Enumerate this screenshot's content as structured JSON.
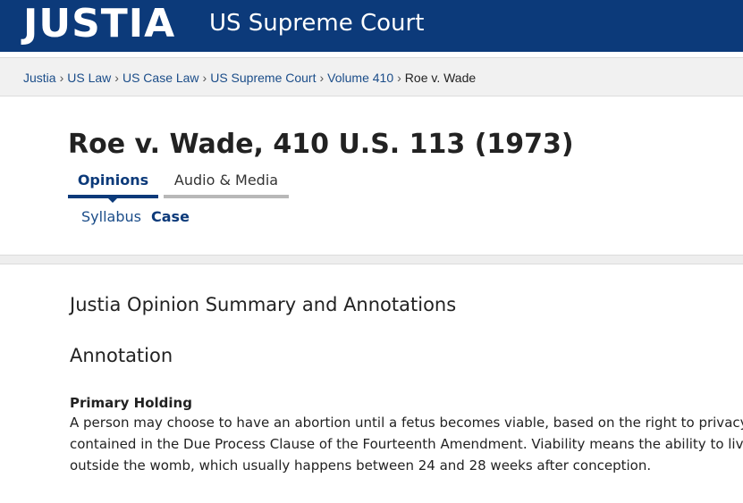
{
  "header": {
    "brand": "JUSTIA",
    "section": "US Supreme Court"
  },
  "breadcrumb": {
    "items": [
      "Justia",
      "US Law",
      "US Case Law",
      "US Supreme Court",
      "Volume 410"
    ],
    "separator": "›",
    "current": "Roe v. Wade"
  },
  "case": {
    "title": "Roe v. Wade, 410 U.S. 113 (1973)"
  },
  "tabs": {
    "active": "Opinions",
    "inactive": "Audio & Media"
  },
  "subtabs": {
    "syllabus": "Syllabus",
    "case": "Case"
  },
  "content": {
    "summary_heading": "Justia Opinion Summary and Annotations",
    "annotation_heading": "Annotation",
    "holding_label": "Primary Holding",
    "holding_lines": [
      "A person may choose to have an abortion until a fetus becomes viable, based on the right to privacy",
      "contained in the Due Process Clause of the Fourteenth Amendment. Viability means the ability to live",
      "outside the womb, which usually happens between 24 and 28 weeks after conception."
    ]
  },
  "colors": {
    "header_bg": "#0c3a7a",
    "link": "#1b4d89",
    "active_tab": "#0c3a7a",
    "inactive_tab_border": "#b8b8b8"
  }
}
